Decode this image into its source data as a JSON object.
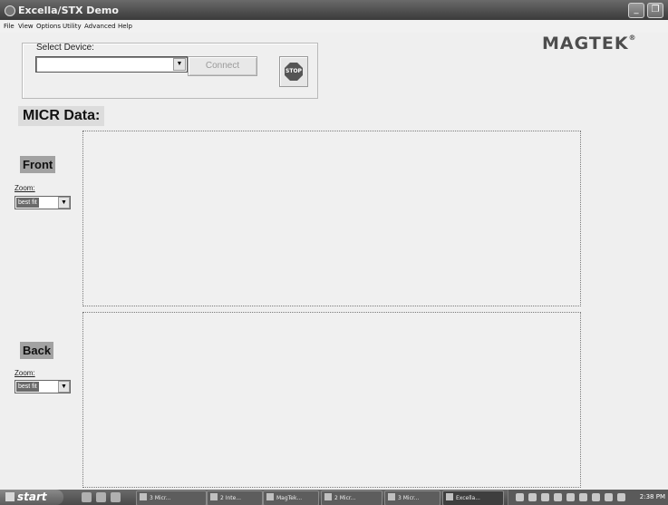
{
  "window": {
    "title": "Excella/STX Demo",
    "minimize_glyph": "_",
    "restore_glyph": "❐"
  },
  "menu": [
    "File",
    "View",
    "Options",
    "Utility",
    "Advanced",
    "Help"
  ],
  "device": {
    "label": "Select Device:",
    "selected_value": "",
    "dropdown_glyph": "▼",
    "connect_label": "Connect",
    "stop_label": "STOP"
  },
  "logo": {
    "text": "MAGTEK",
    "mark": "®"
  },
  "micr": {
    "heading": "MICR Data:"
  },
  "front": {
    "label": "Front",
    "zoom_label": "Zoom:",
    "zoom_value": "best fit"
  },
  "back": {
    "label": "Back",
    "zoom_label": "Zoom:",
    "zoom_value": "best fit"
  },
  "taskbar": {
    "start_label": "start",
    "tasks": [
      "3 Micr...",
      "2 Inte...",
      "MagTek...",
      "2 Micr...",
      "3 Micr...",
      "Excella..."
    ],
    "clock": "2:38 PM"
  },
  "colors": {
    "titlebar": "#4a4a4a",
    "panel_bg": "#efefef",
    "label_highlight": "#a2a2a2"
  }
}
